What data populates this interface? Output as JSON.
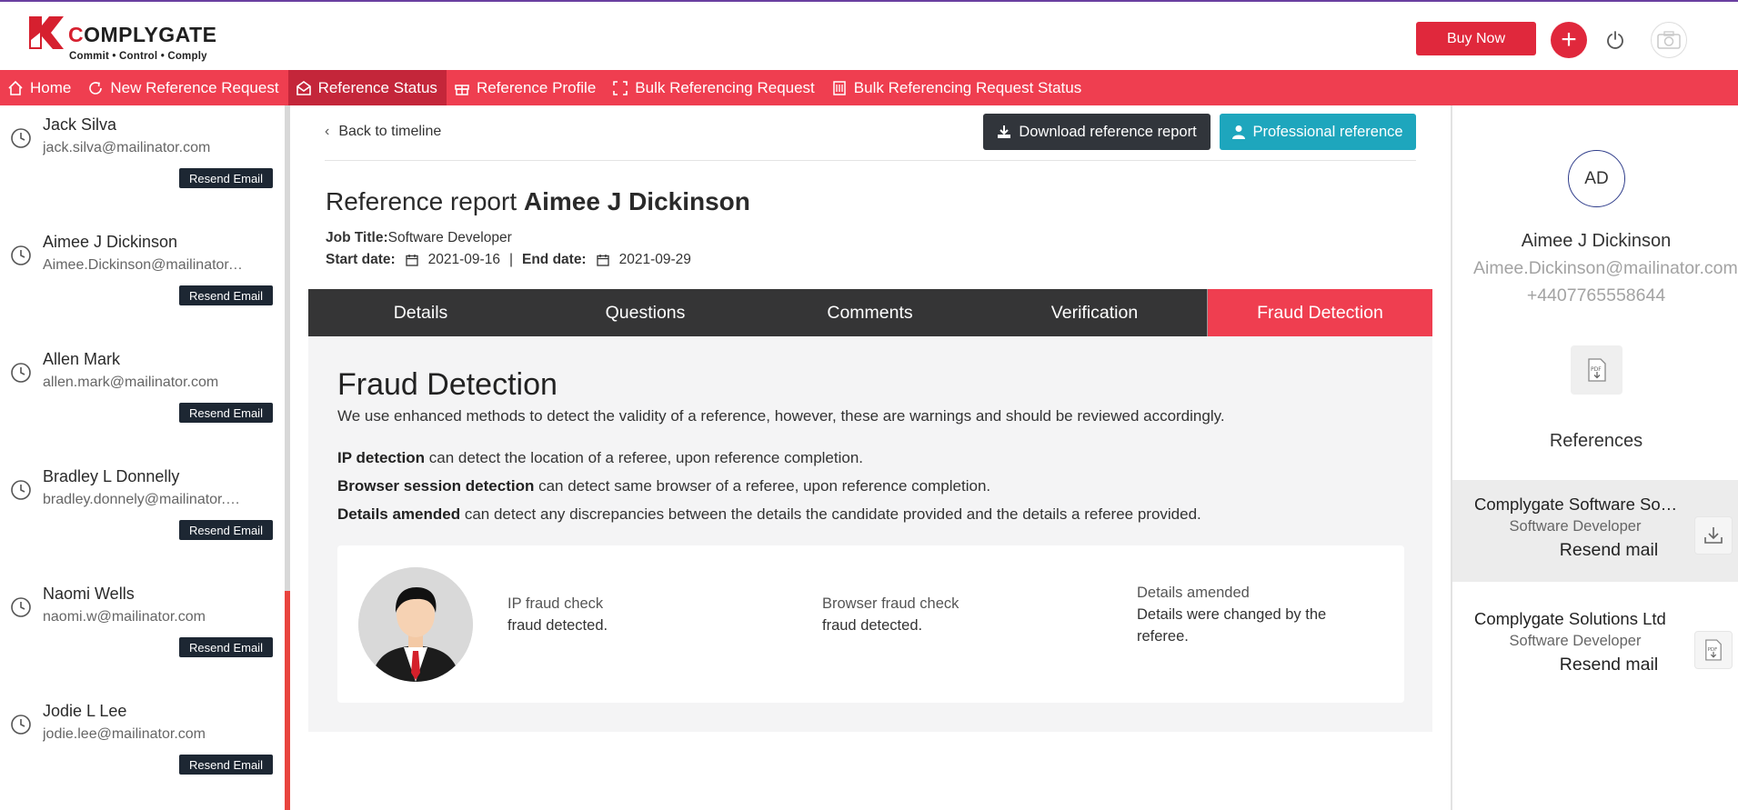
{
  "header": {
    "brand_part1": "C",
    "brand_part2": "OMPLYGATE",
    "tagline": "Commit • Control • Comply",
    "buy_label": "Buy Now",
    "plus_glyph": "+",
    "accent_color": "#ef3e50"
  },
  "nav": {
    "items": [
      {
        "label": "Home",
        "icon": "home-icon"
      },
      {
        "label": "New Reference Request",
        "icon": "refresh-icon"
      },
      {
        "label": "Reference Status",
        "icon": "mail-open-icon",
        "active": true
      },
      {
        "label": "Reference Profile",
        "icon": "gift-icon"
      },
      {
        "label": "Bulk Referencing Request",
        "icon": "expand-icon"
      },
      {
        "label": "Bulk Referencing Request Status",
        "icon": "building-icon"
      }
    ]
  },
  "candidates": [
    {
      "name": "Jack Silva",
      "email": "jack.silva@mailinator.com",
      "action": "Resend Email"
    },
    {
      "name": "Aimee J Dickinson",
      "email": "Aimee.Dickinson@mailinator.com",
      "action": "Resend Email"
    },
    {
      "name": "Allen Mark",
      "email": "allen.mark@mailinator.com",
      "action": "Resend Email"
    },
    {
      "name": "Bradley L Donnelly",
      "email": "bradley.donnely@mailinator.com",
      "action": "Resend Email"
    },
    {
      "name": "Naomi Wells",
      "email": "naomi.w@mailinator.com",
      "action": "Resend Email"
    },
    {
      "name": "Jodie L Lee",
      "email": "jodie.lee@mailinator.com",
      "action": "Resend Email"
    }
  ],
  "main": {
    "back_label": "Back to timeline",
    "download_label": "Download reference report",
    "professional_label": "Professional reference",
    "title_prefix": "Reference report",
    "title_name": "Aimee J Dickinson",
    "job_title_label": "Job Title:",
    "job_title": "Software Developer",
    "start_label": "Start date:",
    "start_date": "2021-09-16",
    "separator": "|",
    "end_label": "End date:",
    "end_date": "2021-09-29",
    "tabs": [
      "Details",
      "Questions",
      "Comments",
      "Verification",
      "Fraud Detection"
    ],
    "active_tab": "Fraud Detection"
  },
  "fraud": {
    "title": "Fraud Detection",
    "description": "We use enhanced methods to detect the validity of a reference, however, these are warnings and should be reviewed accordingly.",
    "lines": [
      {
        "bold": "IP detection",
        "text": " can detect the location of a referee, upon reference completion."
      },
      {
        "bold": "Browser session detection",
        "text": " can detect same browser of a referee, upon reference completion."
      },
      {
        "bold": "Details amended",
        "text": " can detect any discrepancies between the details the candidate provided and the details a referee provided."
      }
    ],
    "checks": [
      {
        "label": "IP fraud check",
        "value": "fraud detected."
      },
      {
        "label": "Browser fraud check",
        "value": "fraud detected."
      },
      {
        "label": "Details amended",
        "value": "Details were changed by the referee."
      }
    ]
  },
  "profile": {
    "initials": "AD",
    "name": "Aimee J Dickinson",
    "email": "Aimee.Dickinson@mailinator.com",
    "phone": "+4407765558644",
    "references_title": "References",
    "references": [
      {
        "title": "Complygate Software Solutions",
        "subtitle": "Software Developer",
        "action": "Resend mail",
        "icon": "download-icon"
      },
      {
        "title": "Complygate Solutions Ltd",
        "subtitle": "Software Developer",
        "action": "Resend mail",
        "icon": "pdf-icon"
      }
    ]
  }
}
